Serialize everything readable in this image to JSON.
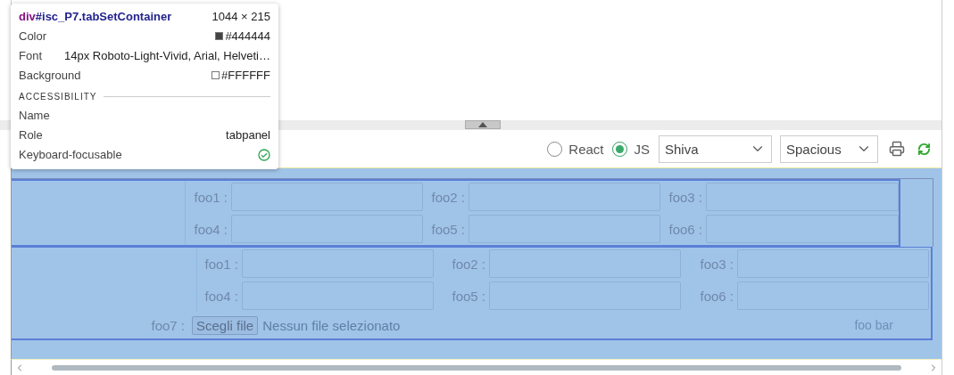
{
  "inspector": {
    "tag": "div",
    "selector": "#isc_P7.tabSetContainer",
    "size": "1044 × 215",
    "properties": [
      {
        "kind": "swatch",
        "label": "Color",
        "value": "#444444",
        "color": "#444444"
      },
      {
        "kind": "text",
        "label": "Font",
        "value": "14px Roboto-Light-Vivid, Arial, Helveti…"
      },
      {
        "kind": "swatch",
        "label": "Background",
        "value": "#FFFFFF",
        "color": "#ffffff"
      }
    ],
    "accessibility_heading": "ACCESSIBILITY",
    "accessibility": [
      {
        "kind": "text",
        "label": "Name"
      },
      {
        "kind": "text",
        "label": "Role",
        "value": "tabpanel"
      },
      {
        "kind": "check",
        "label": "Keyboard-focusable",
        "checked": true
      }
    ]
  },
  "toolbar": {
    "radios": [
      {
        "label": "React",
        "selected": false
      },
      {
        "label": "JS",
        "selected": true
      }
    ],
    "selects": [
      {
        "value": "Shiva"
      },
      {
        "value": "Spacious"
      }
    ]
  },
  "forms": [
    {
      "rows": [
        [
          {
            "label": "foo1 :"
          },
          {
            "label": "foo2 :"
          },
          {
            "label": "foo3 :"
          }
        ],
        [
          {
            "label": "foo4 :"
          },
          {
            "label": "foo5 :"
          },
          {
            "label": "foo6 :"
          }
        ]
      ]
    },
    {
      "rows": [
        [
          {
            "label": "foo1 :"
          },
          {
            "label": "foo2 :"
          },
          {
            "label": "foo3 :"
          }
        ],
        [
          {
            "label": "foo4 :"
          },
          {
            "label": "foo5 :"
          },
          {
            "label": "foo6 :"
          }
        ]
      ],
      "file": {
        "label": "foo7 :",
        "button": "Scegli file",
        "status": "Nessun file selezionato"
      },
      "footer": "foo bar"
    }
  ]
}
